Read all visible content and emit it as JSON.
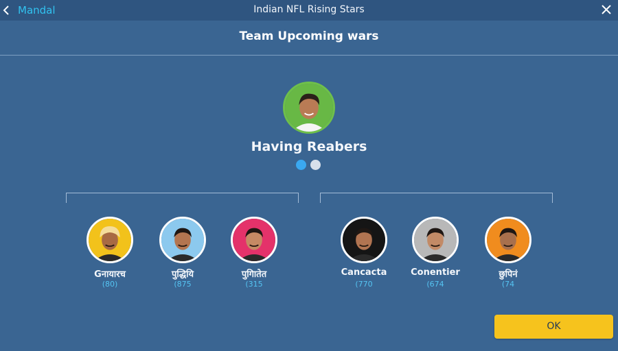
{
  "window": {
    "title": "Indian NFL Rising Stars",
    "back_label": "Mandal"
  },
  "section": {
    "title": "Team Upcoming wars"
  },
  "leader": {
    "name": "Having Reabers"
  },
  "pager": {
    "pages": 2,
    "active": 1
  },
  "members": [
    {
      "name": "Gनायारच",
      "score": "(80)",
      "ring_color": "#f2c21b"
    },
    {
      "name": "पुद्धियि",
      "score": "(875",
      "ring_color": "#8cc9ee"
    },
    {
      "name": "पुगिातेत",
      "score": "(315",
      "ring_color": "#e4326a"
    },
    {
      "name": "Cancacta",
      "score": "(770",
      "ring_color": "#151515"
    },
    {
      "name": "Conentier",
      "score": "(674",
      "ring_color": "#b8b8b8"
    },
    {
      "name": "छुपिनं",
      "score": "(74",
      "ring_color": "#f08c1e"
    }
  ],
  "actions": {
    "ok_label": "OK"
  },
  "colors": {
    "background": "#3a6592",
    "accent": "#31c3f0",
    "ok_button": "#f6c31d"
  },
  "icons": {
    "back": "chevron-left-icon",
    "close": "close-icon"
  }
}
